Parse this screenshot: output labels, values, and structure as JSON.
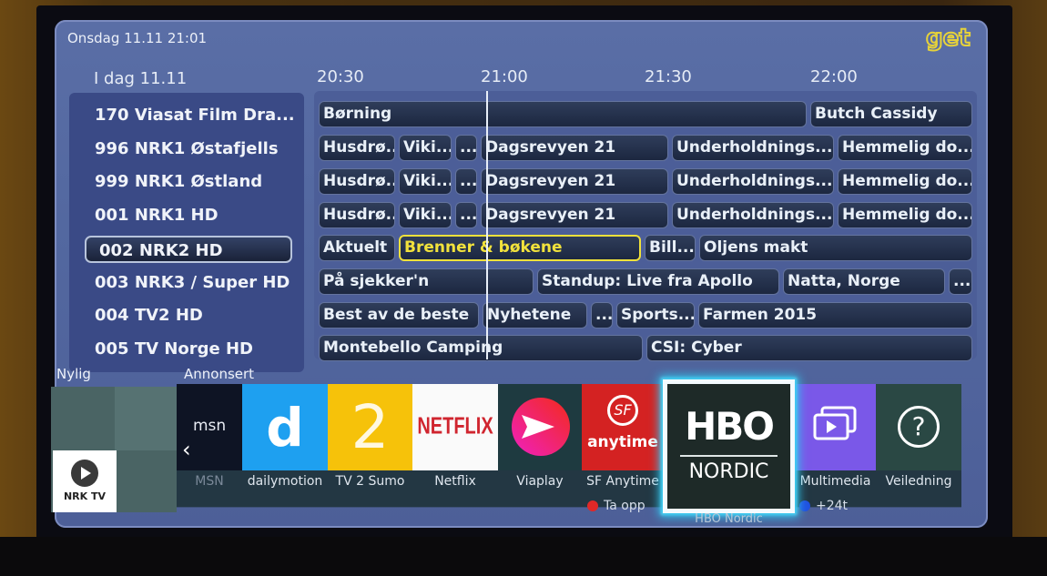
{
  "header": {
    "datetime": "Onsdag 11.11 21:01",
    "brand": "get",
    "brand_color": "#e6d23a",
    "day_label": "I dag 11.11",
    "time_slots": [
      "20:30",
      "21:00",
      "21:30",
      "22:00"
    ]
  },
  "channels": [
    {
      "label": "170 Viasat Film Dra...",
      "selected": false
    },
    {
      "label": "996 NRK1 Østafjells",
      "selected": false
    },
    {
      "label": "999 NRK1 Østland",
      "selected": false
    },
    {
      "label": "001 NRK1 HD",
      "selected": false
    },
    {
      "label": "002 NRK2 HD",
      "selected": true
    },
    {
      "label": "003 NRK3 / Super HD",
      "selected": false
    },
    {
      "label": "004 TV2 HD",
      "selected": false
    },
    {
      "label": "005 TV Norge HD",
      "selected": false
    }
  ],
  "guide": {
    "rows": [
      [
        "Børning",
        "Butch Cassidy"
      ],
      [
        "Husdrø...",
        "Viki...",
        "...",
        "Dagsrevyen 21",
        "Underholdnings...",
        "Hemmelig do..."
      ],
      [
        "Husdrø...",
        "Viki...",
        "...",
        "Dagsrevyen 21",
        "Underholdnings...",
        "Hemmelig do..."
      ],
      [
        "Husdrø...",
        "Viki...",
        "...",
        "Dagsrevyen 21",
        "Underholdnings...",
        "Hemmelig do..."
      ],
      [
        "Aktuelt",
        "Brenner & bøkene",
        "Bill...",
        "Oljens makt"
      ],
      [
        "På sjekker'n",
        "Standup: Live fra Apollo",
        "Natta, Norge",
        "..."
      ],
      [
        "Best av de beste",
        "Nyhetene",
        "...",
        "Sports...",
        "Farmen 2015"
      ],
      [
        "Montebello Camping",
        "CSI: Cyber"
      ]
    ],
    "focused_program": "Brenner & bøkene",
    "focus_color": "#f0e13a"
  },
  "apps_bar": {
    "tabs": [
      "Nylig",
      "Annonsert"
    ],
    "recent": {
      "label": "NRK TV"
    },
    "apps": [
      {
        "name": "MSN",
        "logo": "msn",
        "color": "#0e1424"
      },
      {
        "name": "dailymotion",
        "logo": "d",
        "color": "#1ea0f0"
      },
      {
        "name": "TV 2 Sumo",
        "logo": "2",
        "color": "#f6c20a"
      },
      {
        "name": "Netflix",
        "logo": "NETFLIX",
        "color": "#fafafa"
      },
      {
        "name": "Viaplay",
        "logo": "viaplay-icon",
        "color": "#1e3a40"
      },
      {
        "name": "SF Anytime",
        "logo": "anytime",
        "color": "#d42222"
      },
      {
        "name": "HBO Nordic",
        "logo_top": "HBO",
        "logo_bottom": "NORDIC",
        "color": "#1e2a28",
        "focused": true
      },
      {
        "name": "Multimedia",
        "logo": "multimedia-icon",
        "color": "#7a58e8"
      },
      {
        "name": "Veiledning",
        "logo": "?",
        "color": "#2a4844"
      }
    ],
    "hints": [
      {
        "label": "Ta opp",
        "color": "#e02828"
      },
      {
        "label": "+24t",
        "color": "#2050e0"
      }
    ]
  }
}
